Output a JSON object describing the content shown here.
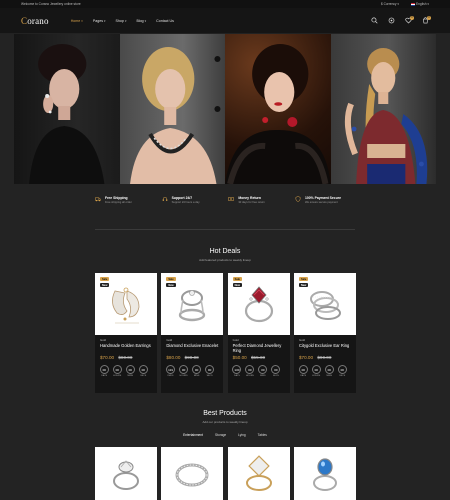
{
  "topbar": {
    "welcome": "Welcome to Corano Jewellery online store",
    "currency": "$ Currency",
    "language": "English"
  },
  "header": {
    "logo_first": "C",
    "logo_rest": "orano",
    "nav": [
      {
        "label": "Home",
        "caret": true,
        "active": true
      },
      {
        "label": "Pages",
        "caret": true
      },
      {
        "label": "Shop",
        "caret": true
      },
      {
        "label": "Blog",
        "caret": true
      },
      {
        "label": "Contact Us",
        "caret": false
      }
    ],
    "wishlist_count": "0",
    "cart_count": "0",
    "accent": "#d7a24a"
  },
  "features": [
    {
      "title": "Free Shipping",
      "sub": "Free shipping all order",
      "icon": "truck-icon"
    },
    {
      "title": "Support 24/7",
      "sub": "Support 24 hours a day",
      "icon": "headset-icon"
    },
    {
      "title": "Money Return",
      "sub": "30 days for free return",
      "icon": "money-icon"
    },
    {
      "title": "100% Payment Secure",
      "sub": "We ensure secure payment",
      "icon": "shield-icon"
    }
  ],
  "hot_deals": {
    "title": "Hot Deals",
    "subtitle": "Add featured products to weekly lineup",
    "products": [
      {
        "sale": "Sale",
        "new": "New",
        "category": "Gold",
        "name": "Handmade Golden Earrings",
        "price": "$70.00",
        "old_price": "$80.00",
        "countdown": [
          {
            "v": "00",
            "l": "DAYS"
          },
          {
            "v": "00",
            "l": "HOURS"
          },
          {
            "v": "00",
            "l": "MINS"
          },
          {
            "v": "00",
            "l": "SECS"
          }
        ]
      },
      {
        "sale": "Sale",
        "new": "New",
        "category": "Gold",
        "name": "Diamond Exclusive Enacelet",
        "price": "$80.00",
        "old_price": "$90.00",
        "countdown": [
          {
            "v": "131",
            "l": "DAYS"
          },
          {
            "v": "00",
            "l": "HOURS"
          },
          {
            "v": "00",
            "l": "MINS"
          },
          {
            "v": "00",
            "l": "SECS"
          }
        ]
      },
      {
        "sale": "Sale",
        "new": "New",
        "category": "Gold",
        "name": "Perfect Diamond Jewellery Ring",
        "price": "$50.00",
        "old_price": "$55.00",
        "countdown": [
          {
            "v": "130",
            "l": "DAYS"
          },
          {
            "v": "00",
            "l": "HOURS"
          },
          {
            "v": "00",
            "l": "MINS"
          },
          {
            "v": "00",
            "l": "SECS"
          }
        ]
      },
      {
        "sale": "Sale",
        "new": "New",
        "category": "Gold",
        "name": "Citygold Exclusive Ear Ring",
        "price": "$70.00",
        "old_price": "$90.00",
        "countdown": [
          {
            "v": "00",
            "l": "DAYS"
          },
          {
            "v": "00",
            "l": "HOURS"
          },
          {
            "v": "00",
            "l": "MINS"
          },
          {
            "v": "00",
            "l": "SECS"
          }
        ]
      }
    ]
  },
  "best_products": {
    "title": "Best Products",
    "subtitle": "Add our products to weekly lineup",
    "tabs": [
      "Entertainment",
      "Storage",
      "Lying",
      "Tables"
    ]
  }
}
